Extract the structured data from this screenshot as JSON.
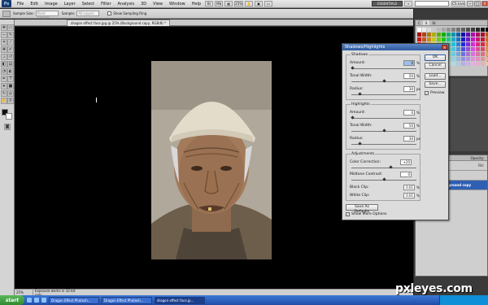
{
  "app": {
    "logo": "Ps"
  },
  "menu": [
    "File",
    "Edit",
    "Image",
    "Layer",
    "Select",
    "Filter",
    "Analysis",
    "3D",
    "View",
    "Window",
    "Help"
  ],
  "workspace": {
    "label": "ESSENTIALS",
    "cs_live": "CS Live"
  },
  "options_bar": {
    "sample_size_label": "Sample Size:",
    "sample_size_value": "Point Sample",
    "sample_label": "Sample:",
    "sample_value": "All Layers",
    "show_ring_label": "Show Sampling Ring"
  },
  "document": {
    "tab_title": "dragon effect face.jpg @ 25% (Background copy, RGB/8) *",
    "zoom": "25%",
    "status_info": "Exposure works in 32-bit only"
  },
  "dialog": {
    "title": "Shadows/Highlights",
    "shadows": {
      "title": "Shadows",
      "amount_label": "Amount:",
      "amount": "0",
      "amount_unit": "%",
      "tonal_label": "Tonal Width:",
      "tonal": "50",
      "tonal_unit": "%",
      "radius_label": "Radius:",
      "radius": "30",
      "radius_unit": "px"
    },
    "highlights": {
      "title": "Highlights",
      "amount_label": "Amount:",
      "amount": "0",
      "amount_unit": "%",
      "tonal_label": "Tonal Width:",
      "tonal": "50",
      "tonal_unit": "%",
      "radius_label": "Radius:",
      "radius": "30",
      "radius_unit": "px"
    },
    "adjustments": {
      "title": "Adjustments",
      "color_label": "Color Correction:",
      "color": "+20",
      "midtone_label": "Midtone Contrast:",
      "midtone": "0",
      "black_label": "Black Clip:",
      "black": "0.01",
      "black_unit": "%",
      "white_label": "White Clip:",
      "white": "0.01",
      "white_unit": "%"
    },
    "buttons": {
      "ok": "OK",
      "cancel": "Cancel",
      "load": "Load...",
      "save": "Save...",
      "save_defaults": "Save As Defaults"
    },
    "preview_label": "Preview",
    "more_options_label": "Show More Options",
    "slider_levels": {
      "s_amount": 0.0,
      "s_tonal": 0.5,
      "s_radius": 0.12,
      "h_amount": 0.0,
      "h_tonal": 0.5,
      "h_radius": 0.12,
      "color": 0.6,
      "midtone": 0.5
    }
  },
  "layers": {
    "opacity_label": "Opacity:",
    "fill_label": "Fill:",
    "active_layer": "ground copy"
  },
  "taskbar": {
    "start": "start",
    "tasks": [
      "Dragon Effect Photosh...",
      "Dragon Effect Photosh...",
      "dragon effect face.jp..."
    ]
  },
  "watermark": "pxleyes.com"
}
